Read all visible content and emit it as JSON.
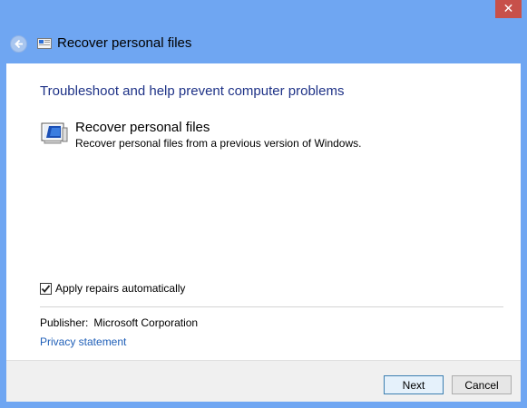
{
  "window": {
    "title": "Recover personal files",
    "close_glyph": "✕"
  },
  "nav": {
    "back_icon": "back-arrow-icon",
    "title": "Recover personal files"
  },
  "main": {
    "heading": "Troubleshoot and help prevent computer problems",
    "troubleshooter": {
      "title": "Recover personal files",
      "description": "Recover personal files from a previous version of Windows."
    },
    "apply_repairs": {
      "label": "Apply repairs automatically",
      "checked": true
    },
    "publisher": {
      "label": "Publisher:",
      "value": "Microsoft Corporation"
    },
    "privacy_link": "Privacy statement"
  },
  "footer": {
    "next_label": "Next",
    "cancel_label": "Cancel"
  },
  "colors": {
    "window_frame": "#6fa6f2",
    "heading": "#1e3287",
    "link": "#1f5fb8",
    "close_button": "#c7504a"
  }
}
